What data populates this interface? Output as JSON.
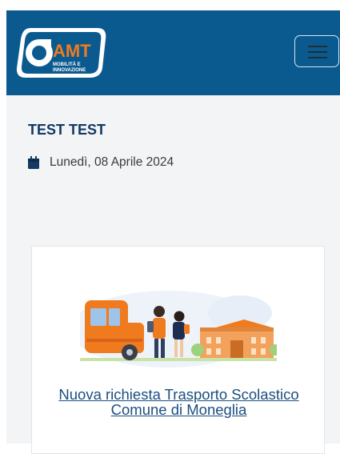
{
  "header": {
    "logo": {
      "brand": "AMT",
      "tagline": "MOBILITÀ E INNOVAZIONE"
    },
    "menu_icon": "hamburger-icon"
  },
  "content": {
    "title": "TEST TEST",
    "date_icon": "calendar-icon",
    "date": "Lunedì, 08 Aprile 2024"
  },
  "card": {
    "image": "school-bus-students-illustration",
    "link_text": "Nuova richiesta Trasporto Scolastico Comune di Moneglia"
  },
  "colors": {
    "header_bg": "#0b5a8f",
    "logo_orange": "#f07b1f",
    "title": "#123a63",
    "link": "#1c4e80"
  }
}
